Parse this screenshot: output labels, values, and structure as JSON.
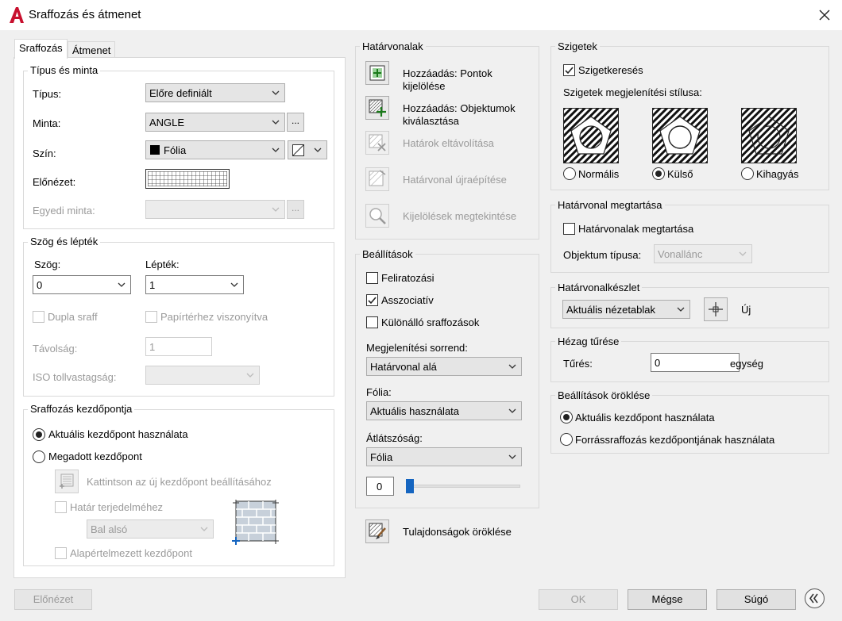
{
  "window": {
    "title": "Sraffozás és átmenet"
  },
  "tabs": [
    "Sraffozás",
    "Átmenet"
  ],
  "type_pattern": {
    "title": "Típus és minta",
    "type_label": "Típus:",
    "type_value": "Előre definiált",
    "pattern_label": "Minta:",
    "pattern_value": "ANGLE",
    "color_label": "Szín:",
    "color_value": "Fólia",
    "preview_label": "Előnézet:",
    "custom_label": "Egyedi minta:",
    "more_button": "..."
  },
  "angle_scale": {
    "title": "Szög és lépték",
    "angle_label": "Szög:",
    "angle_value": "0",
    "scale_label": "Lépték:",
    "scale_value": "1",
    "double_label": "Dupla sraff",
    "paper_label": "Papírtérhez viszonyítva",
    "spacing_label": "Távolság:",
    "spacing_value": "1",
    "iso_label": "ISO tollvastagság:"
  },
  "origin": {
    "title": "Sraffozás kezdőpontja",
    "current_label": "Aktuális kezdőpont használata",
    "specified_label": "Megadott kezdőpont",
    "click_label": "Kattintson az új kezdőpont beállításához",
    "extents_label": "Határ terjedelméhez",
    "corner_value": "Bal alsó",
    "default_label": "Alapértelmezett kezdőpont"
  },
  "boundaries": {
    "title": "Határvonalak",
    "add_points": "Hozzáadás: Pontok kijelölése",
    "add_objects": "Hozzáadás: Objektumok kiválasztása",
    "remove": "Határok eltávolítása",
    "recreate": "Határvonal újraépítése",
    "view": "Kijelölések megtekintése"
  },
  "options": {
    "title": "Beállítások",
    "annotative": "Feliratozási",
    "associative": "Asszociatív",
    "separate": "Különálló sraffozások",
    "draw_order_label": "Megjelenítési sorrend:",
    "draw_order_value": "Határvonal alá",
    "layer_label": "Fólia:",
    "layer_value": "Aktuális használata",
    "transparency_label": "Átlátszóság:",
    "transparency_value": "Fólia",
    "transparency_number": "0"
  },
  "inherit": {
    "label": "Tulajdonságok öröklése"
  },
  "islands": {
    "title": "Szigetek",
    "detect": "Szigetkeresés",
    "style_label": "Szigetek megjelenítési stílusa:",
    "normal": "Normális",
    "outer": "Külső",
    "ignore": "Kihagyás"
  },
  "retain": {
    "title": "Határvonal megtartása",
    "retain_label": "Határvonalak megtartása",
    "object_type_label": "Objektum típusa:",
    "object_type_value": "Vonallánc"
  },
  "boundary_set": {
    "title": "Határvonalkészlet",
    "value": "Aktuális nézetablak",
    "new_label": "Új"
  },
  "gap": {
    "title": "Hézag tűrése",
    "tolerance_label": "Tűrés:",
    "tolerance_value": "0",
    "units": "egység"
  },
  "inherit_options": {
    "title": "Beállítások öröklése",
    "current": "Aktuális kezdőpont használata",
    "source": "Forrássraffozás kezdőpontjának használata"
  },
  "footer": {
    "preview": "Előnézet",
    "ok": "OK",
    "cancel": "Mégse",
    "help": "Súgó"
  },
  "colors": {
    "accent": "#1565c0",
    "app_red": "#c8102e",
    "border": "#adadad"
  }
}
